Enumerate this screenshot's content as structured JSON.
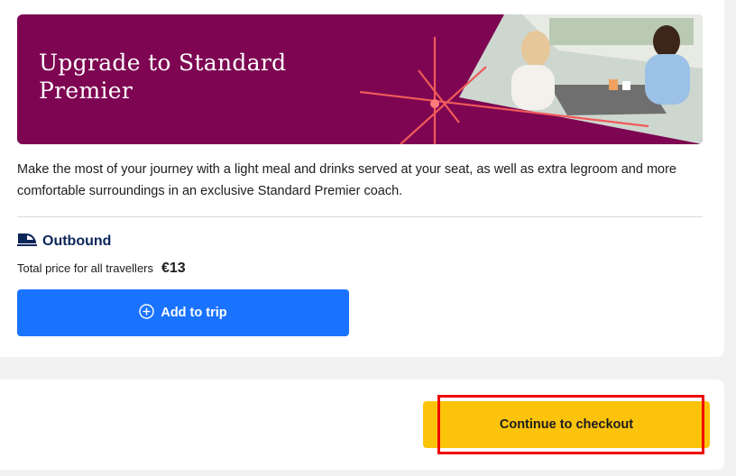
{
  "banner": {
    "title": "Upgrade to Standard Premier",
    "background_color": "#7d0552",
    "image": "passengers-dining-at-table-photo"
  },
  "description": "Make the most of your journey with a light meal and drinks served at your seat, as well as extra legroom and more comfortable surroundings in an exclusive Standard Premier coach.",
  "journey": {
    "direction_label": "Outbound",
    "direction_icon": "train-icon",
    "price_label": "Total price for all travellers",
    "price_value": "€13"
  },
  "actions": {
    "add_label": "Add to trip",
    "add_icon": "plus-circle-icon",
    "checkout_label": "Continue to checkout"
  },
  "colors": {
    "primary_blue": "#1a73ff",
    "accent_yellow": "#fcc30b",
    "navy": "#0b2559",
    "highlight_red": "#ee0000"
  }
}
